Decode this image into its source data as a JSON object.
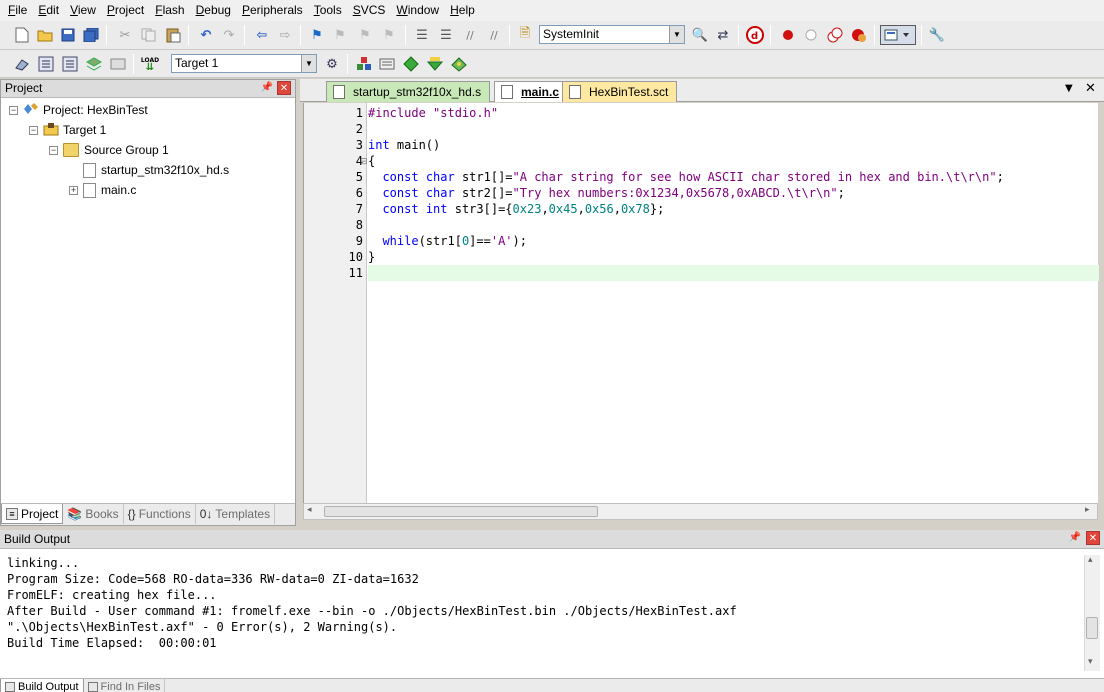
{
  "menu": [
    {
      "label": "File",
      "u": "F",
      "rest": "ile"
    },
    {
      "label": "Edit",
      "u": "E",
      "rest": "dit"
    },
    {
      "label": "View",
      "u": "V",
      "rest": "iew"
    },
    {
      "label": "Project",
      "u": "P",
      "rest": "roject"
    },
    {
      "label": "Flash",
      "u": "F",
      "rest": "lash"
    },
    {
      "label": "Debug",
      "u": "D",
      "rest": "ebug"
    },
    {
      "label": "Peripherals",
      "u": "P",
      "rest": "eripherals"
    },
    {
      "label": "Tools",
      "u": "T",
      "rest": "ools"
    },
    {
      "label": "SVCS",
      "u": "S",
      "rest": "VCS"
    },
    {
      "label": "Window",
      "u": "W",
      "rest": "indow"
    },
    {
      "label": "Help",
      "u": "H",
      "rest": "elp"
    }
  ],
  "toolbar": {
    "function_combo": "SystemInit",
    "target_combo": "Target 1",
    "load_label": "LOAD"
  },
  "project": {
    "title": "Project",
    "tree": {
      "project": "Project: HexBinTest",
      "target": "Target 1",
      "group": "Source Group 1",
      "file1": "startup_stm32f10x_hd.s",
      "file2": "main.c"
    },
    "tabs": {
      "project": "Project",
      "books": "Books",
      "functions": "Functions",
      "templates": "Templates"
    }
  },
  "editor": {
    "tabs": [
      {
        "label": "startup_stm32f10x_hd.s"
      },
      {
        "label": "main.c"
      },
      {
        "label": "HexBinTest.sct"
      }
    ],
    "line_numbers": [
      "1",
      "2",
      "3",
      "4",
      "5",
      "6",
      "7",
      "8",
      "9",
      "10",
      "11"
    ]
  },
  "build": {
    "title": "Build Output",
    "lines": [
      "linking...",
      "Program Size: Code=568 RO-data=336 RW-data=0 ZI-data=1632",
      "FromELF: creating hex file...",
      "After Build - User command #1: fromelf.exe --bin -o ./Objects/HexBinTest.bin ./Objects/HexBinTest.axf",
      "\".\\Objects\\HexBinTest.axf\" - 0 Error(s), 2 Warning(s).",
      "Build Time Elapsed:  00:00:01"
    ],
    "tabs": {
      "build_output": "Build Output",
      "find_in_files": "Find In Files"
    }
  },
  "colors": {
    "keyword": "#0000ff",
    "string": "#800080",
    "number": "#008080",
    "current_line": "#e5fbe5"
  }
}
